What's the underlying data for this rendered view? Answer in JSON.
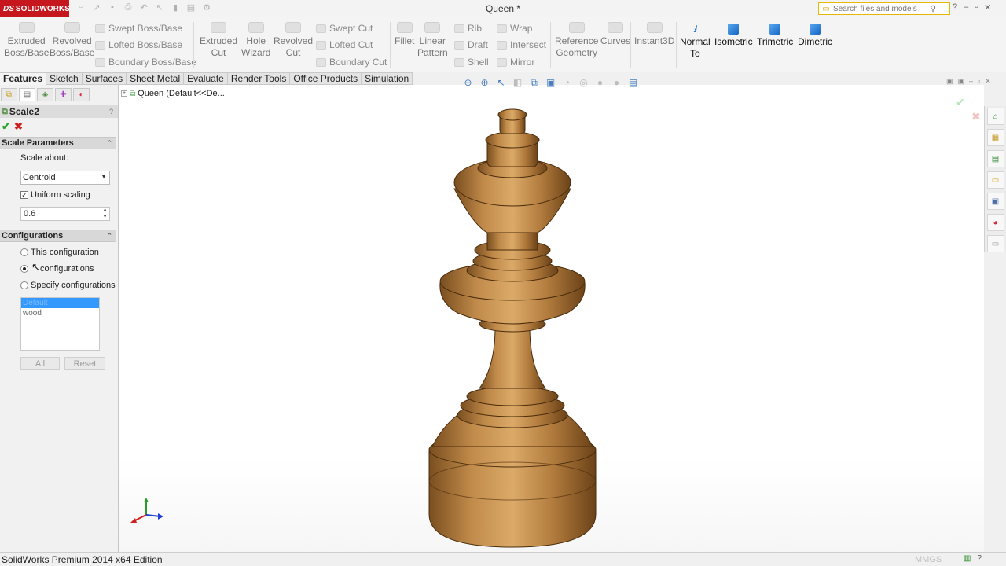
{
  "titlebar": {
    "logo_text": "SOLIDWORKS",
    "document_title": "Queen *",
    "search_placeholder": "Search files and models"
  },
  "features_toolbar": {
    "extruded_boss": [
      "Extruded",
      "Boss/Base"
    ],
    "revolved_boss": [
      "Revolved",
      "Boss/Base"
    ],
    "swept_boss": "Swept Boss/Base",
    "lofted_boss": "Lofted Boss/Base",
    "boundary_boss": "Boundary Boss/Base",
    "extruded_cut": [
      "Extruded",
      "Cut"
    ],
    "hole_wizard": [
      "Hole",
      "Wizard"
    ],
    "revolved_cut": [
      "Revolved",
      "Cut"
    ],
    "swept_cut": "Swept Cut",
    "lofted_cut": "Lofted Cut",
    "boundary_cut": "Boundary Cut",
    "fillet": "Fillet",
    "linear_pattern": [
      "Linear",
      "Pattern"
    ],
    "rib": "Rib",
    "draft": "Draft",
    "shell": "Shell",
    "wrap": "Wrap",
    "intersect": "Intersect",
    "mirror": "Mirror",
    "reference_geometry": [
      "Reference",
      "Geometry"
    ],
    "curves": "Curves",
    "instant3d": "Instant3D",
    "normal_to": [
      "Normal",
      "To"
    ],
    "isometric": "Isometric",
    "trimetric": "Trimetric",
    "dimetric": "Dimetric"
  },
  "tabs": [
    "Features",
    "Sketch",
    "Surfaces",
    "Sheet Metal",
    "Evaluate",
    "Render Tools",
    "Office Products",
    "Simulation"
  ],
  "property_manager": {
    "title": "Scale2",
    "scale_parameters": {
      "header": "Scale Parameters",
      "scale_about_label": "Scale about:",
      "scale_about_value": "Centroid",
      "uniform_label": "Uniform scaling",
      "uniform_checked": true,
      "factor": "0.6"
    },
    "configurations": {
      "header": "Configurations",
      "options": [
        "This configuration",
        "configurations",
        "Specify configurations"
      ],
      "selected_index": 1,
      "list": [
        "Default",
        "wood"
      ],
      "all_button": "All",
      "reset_button": "Reset"
    }
  },
  "graphics": {
    "tree_label": "Queen  (Default<<De..."
  },
  "statusbar": {
    "edition": "SolidWorks Premium 2014 x64 Edition",
    "units": "MMGS"
  }
}
